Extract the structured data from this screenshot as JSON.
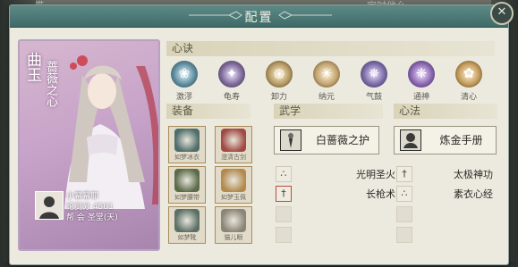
{
  "background": {
    "top_left_text": "喵…喵",
    "top_right_text": "定时他么"
  },
  "window": {
    "title": "配置",
    "close_symbol": "✕"
  },
  "character": {
    "name": "曲玉",
    "title": "蔷薇之心",
    "player_name": "小幕幕耶",
    "score_label": "论剑分",
    "score_value": "4501",
    "guild_label": "帮",
    "guild_name": "会 圣堂(天)"
  },
  "sections": {
    "xinjue": "心诀",
    "zhuangbei": "装备",
    "wuxue": "武学",
    "xinfa": "心法"
  },
  "xinjue_skills": [
    {
      "label": "激漻",
      "icon": "wave-icon",
      "glyph": "❀"
    },
    {
      "label": "龟寿",
      "icon": "turtle-icon",
      "glyph": "✦"
    },
    {
      "label": "卸力",
      "icon": "spiral-icon",
      "glyph": "֍"
    },
    {
      "label": "纳元",
      "icon": "sun-icon",
      "glyph": "☀"
    },
    {
      "label": "气鼓",
      "icon": "vortex-icon",
      "glyph": "✵"
    },
    {
      "label": "通神",
      "icon": "spirit-icon",
      "glyph": "❈"
    },
    {
      "label": "清心",
      "icon": "lotus-icon",
      "glyph": "✿"
    }
  ],
  "equipment": [
    {
      "label": "如梦冰衣",
      "icon": "armor-icon"
    },
    {
      "label": "澄清古剑",
      "icon": "sword-icon"
    },
    {
      "label": "如梦腰带",
      "icon": "belt-icon"
    },
    {
      "label": "如梦玉佩",
      "icon": "pendant-icon"
    },
    {
      "label": "如梦靴",
      "icon": "boots-icon"
    },
    {
      "label": "猫儿眼",
      "icon": "cat-eye-icon"
    }
  ],
  "wuxue": {
    "main": "白蔷薇之护",
    "rows": [
      {
        "text": "光明圣火",
        "icon": "fire-icon",
        "glyph": "∴"
      },
      {
        "text": "长枪术",
        "icon": "spear-icon",
        "glyph": "†"
      }
    ]
  },
  "xinfa": {
    "main": "炼金手册",
    "rows": [
      {
        "text": "太极神功",
        "icon": "taiji-icon",
        "glyph": "†"
      },
      {
        "text": "素衣心经",
        "icon": "scroll-icon",
        "glyph": "∴"
      }
    ]
  },
  "colors": {
    "title_bar": "#3e6b68",
    "panel": "#ece9df",
    "card": "#c7a3c9",
    "accent_red": "#b3503d"
  }
}
